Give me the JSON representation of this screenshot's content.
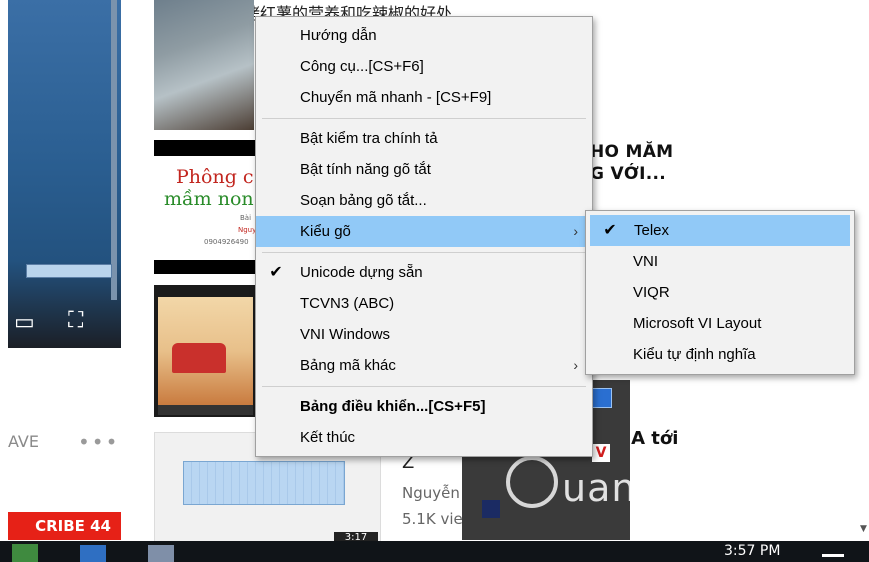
{
  "background": {
    "top_text": "烤红薯的营养和吃辣椒的好处",
    "card_title_line1": "Phông c",
    "card_title_line2": "mầm non",
    "card_small_line1": "Bài",
    "card_small_line2": "Nguy",
    "card_phone": "0904926490",
    "headline_line1": "HO MĂM",
    "headline_line2": "G VỚI...",
    "save_label": "AVE",
    "more_label": "•••",
    "subscribe_label": "CRIBE  44",
    "article_prefix": "ừ A tới",
    "article_letter": "Z",
    "author": "Nguyễn",
    "views": "5.1K vie",
    "watermark": "uantrimang",
    "duration_badge": "3:17"
  },
  "taskbar": {
    "time": "3:57 PM"
  },
  "main_menu": {
    "items": [
      {
        "label": "Hướng dẫn"
      },
      {
        "label": "Công cụ...[CS+F6]"
      },
      {
        "label": "Chuyển mã nhanh - [CS+F9]"
      },
      {
        "label": "Bật kiểm tra chính tả"
      },
      {
        "label": "Bật tính năng gõ tắt"
      },
      {
        "label": "Soạn bảng gõ tắt..."
      },
      {
        "label": "Kiểu gõ",
        "submenu_arrow": "›"
      },
      {
        "label": "Unicode dựng sẵn",
        "check": "✔"
      },
      {
        "label": "TCVN3 (ABC)"
      },
      {
        "label": "VNI Windows"
      },
      {
        "label": "Bảng mã khác",
        "submenu_arrow": "›"
      },
      {
        "label": "Bảng điều khiển...[CS+F5]"
      },
      {
        "label": "Kết thúc"
      }
    ]
  },
  "submenu": {
    "items": [
      {
        "label": "Telex",
        "check": "✔"
      },
      {
        "label": "VNI"
      },
      {
        "label": "VIQR"
      },
      {
        "label": "Microsoft VI Layout"
      },
      {
        "label": "Kiểu tự định nghĩa"
      }
    ]
  },
  "colors": {
    "highlight": "#91c9f7",
    "menu_bg": "#f2f2f2",
    "subscribe_red": "#e62117"
  }
}
